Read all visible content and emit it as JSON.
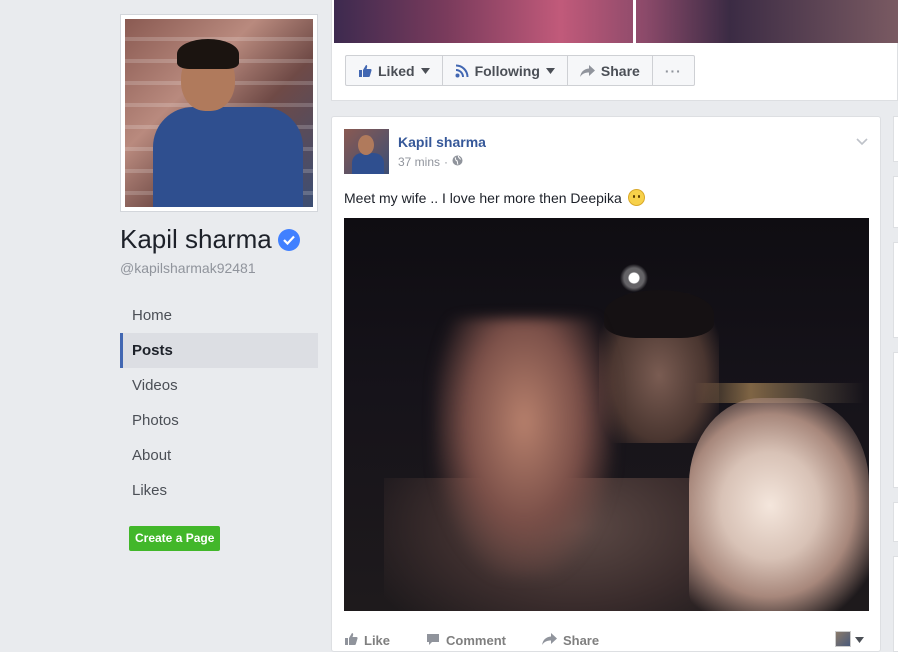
{
  "profile": {
    "name": "Kapil sharma",
    "handle": "@kapilsharmak92481"
  },
  "nav": {
    "items": [
      {
        "label": "Home",
        "active": false
      },
      {
        "label": "Posts",
        "active": true
      },
      {
        "label": "Videos",
        "active": false
      },
      {
        "label": "Photos",
        "active": false
      },
      {
        "label": "About",
        "active": false
      },
      {
        "label": "Likes",
        "active": false
      }
    ],
    "create_page_label": "Create a Page"
  },
  "action_bar": {
    "liked_label": "Liked",
    "following_label": "Following",
    "share_label": "Share",
    "more_label": "···"
  },
  "post": {
    "author": "Kapil sharma",
    "time": "37 mins",
    "separator": "·",
    "text": "Meet my wife .. I love her more then Deepika",
    "actions": {
      "like_label": "Like",
      "comment_label": "Comment",
      "share_label": "Share"
    }
  },
  "colors": {
    "brand_link": "#365899",
    "active_indicator": "#4267b2",
    "create_button": "#42b72a",
    "verified": "#4080ff"
  }
}
